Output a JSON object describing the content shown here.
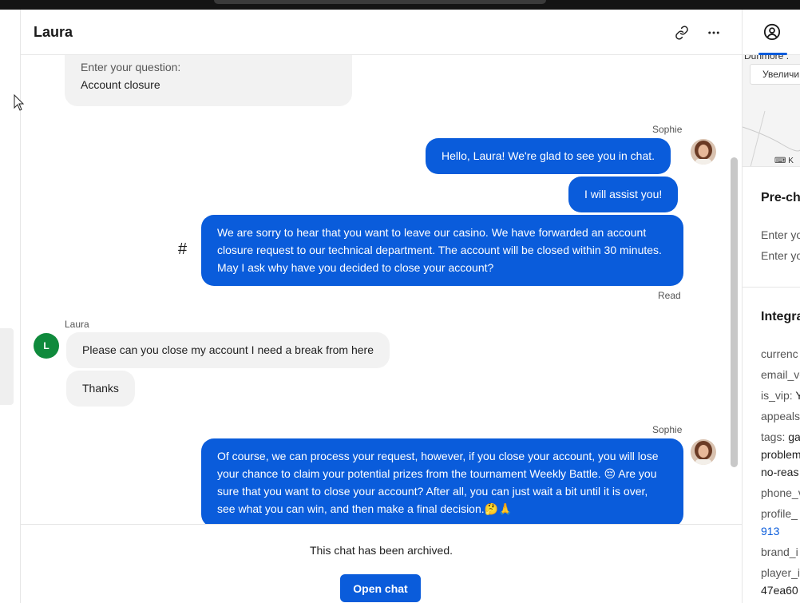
{
  "chat": {
    "title": "Laura",
    "header_icons": [
      "link-icon",
      "more-icon"
    ],
    "messages": {
      "form_label": "Enter your question:",
      "form_value": "Account closure",
      "sophie_name_1": "Sophie",
      "out_1": "Hello, Laura! We're glad to see you in chat.",
      "out_2": "I will assist you!",
      "hash_mark": "#",
      "out_3": "We are sorry to hear that you want to leave our casino. We have forwarded an account closure request to our technical department. The account will be closed within 30 minutes. May I ask why have you decided to close your account?",
      "read_status": "Read",
      "laura_name": "Laura",
      "laura_initial": "L",
      "in_1": "Please can you close my account I need a break from here",
      "in_2": "Thanks",
      "sophie_name_2": "Sophie",
      "out_4": "Of course, we can process your request, however, if you close your account, you will lose your chance to claim your potential prizes from the tournament Weekly Battle. 😔 Are you sure that you want to close your account? After all, you can just wait a bit until it is over, see what you can win, and then make a final decision.🤔🙏"
    },
    "footer": {
      "archived_text": "This chat has been archived.",
      "open_button": "Open chat"
    }
  },
  "right_panel": {
    "tab_icon": "user-circle-icon",
    "map_text": "Dunmore :",
    "map_button": "Увеличи",
    "map_keyboard": "K",
    "prechat_title": "Pre-ch",
    "prechat_line_1": "Enter yo",
    "prechat_line_2": "Enter yo",
    "integration_title": "Integra",
    "fields": [
      {
        "key": "currenc",
        "value": ""
      },
      {
        "key": "email_ve",
        "value": ""
      },
      {
        "key": "is_vip:",
        "value": "Y"
      },
      {
        "key": "appeals",
        "value": ""
      },
      {
        "key": "tags:",
        "value": "ga"
      },
      {
        "key": "problem",
        "value": ""
      },
      {
        "key": "no-reas",
        "value": ""
      },
      {
        "key": "phone_v",
        "value": ""
      },
      {
        "key": "profile_",
        "value": ""
      },
      {
        "key": "913",
        "value": ""
      },
      {
        "key": "brand_i",
        "value": ""
      },
      {
        "key": "player_i",
        "value": ""
      },
      {
        "key": "47ea60",
        "value": ""
      }
    ]
  },
  "colors": {
    "accent": "#0a5cdb",
    "incoming_bubble": "#f2f2f2",
    "avatar_green": "#0f8a3c"
  }
}
